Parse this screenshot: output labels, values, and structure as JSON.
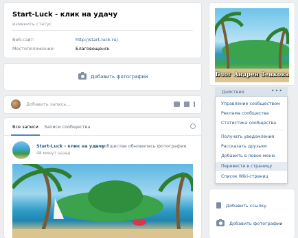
{
  "profile": {
    "name": "Start-Luck - клик на удачу",
    "status": "изменить статус",
    "website_label": "Веб-сайт:",
    "website_value": "http://start-luck.ru/",
    "location_label": "Местоположение:",
    "location_value": "Благовещенск"
  },
  "photos": {
    "add_label": "Добавить фотографии"
  },
  "composer": {
    "placeholder": "Добавить запись..."
  },
  "wall": {
    "tabs": [
      {
        "label": "Все записи",
        "active": true
      },
      {
        "label": "Записи сообщества",
        "active": false
      }
    ],
    "post": {
      "author": "Start-Luck - клик на удачу",
      "action": "в сообществе обновилась фотография",
      "time": "48 минут назад"
    }
  },
  "cover": {
    "title": "Блог Андрея Зенкова"
  },
  "actions": {
    "label": "Действия",
    "dots": "•••",
    "menu": [
      {
        "label": "Управление сообществом"
      },
      {
        "label": "Реклама сообщества"
      },
      {
        "label": "Статистика сообщества"
      },
      {
        "label": "Получать уведомления"
      },
      {
        "label": "Рассказать друзьям"
      },
      {
        "label": "Добавить в левое меню"
      },
      {
        "label": "Перевести в страницу",
        "highlighted": true
      },
      {
        "label": "Список Wiki-страниц"
      }
    ]
  },
  "side": {
    "add_link": "Добавить ссылку",
    "add_photos": "Добавить фотографии"
  },
  "colors": {
    "link": "#2a5885",
    "accent": "#5181b8",
    "background": "#edeef0",
    "menu_highlight": "#e5ebf1"
  }
}
